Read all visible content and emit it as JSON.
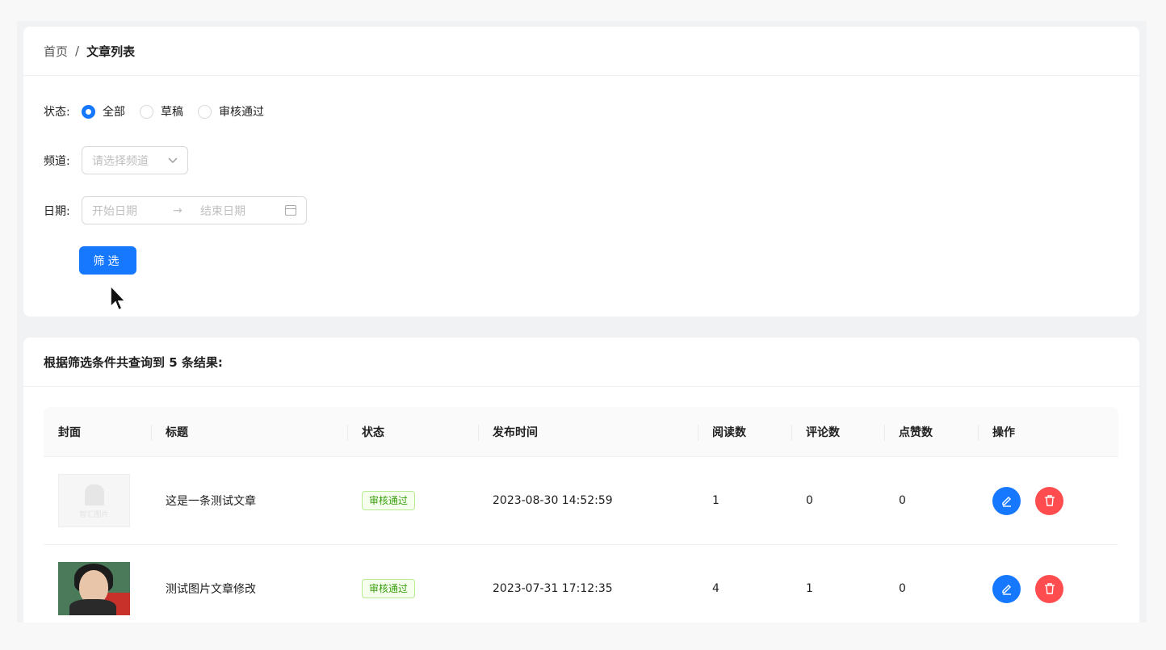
{
  "breadcrumb": {
    "home": "首页",
    "separator": "/",
    "current": "文章列表"
  },
  "filters": {
    "status": {
      "label": "状态:",
      "options": [
        {
          "label": "全部",
          "checked": true
        },
        {
          "label": "草稿",
          "checked": false
        },
        {
          "label": "审核通过",
          "checked": false
        }
      ]
    },
    "channel": {
      "label": "频道:",
      "placeholder": "请选择频道"
    },
    "date": {
      "label": "日期:",
      "start_placeholder": "开始日期",
      "arrow": "→",
      "end_placeholder": "结束日期"
    },
    "submit_label": "筛选"
  },
  "results": {
    "title": "根据筛选条件共查询到 5 条结果:",
    "columns": [
      "封面",
      "标题",
      "状态",
      "发布时间",
      "阅读数",
      "评论数",
      "点赞数",
      "操作"
    ],
    "rows": [
      {
        "cover": "placeholder",
        "cover_text": "智汇图片",
        "title": "这是一条测试文章",
        "status": "审核通过",
        "publish_time": "2023-08-30 14:52:59",
        "reads": "1",
        "comments": "0",
        "likes": "0"
      },
      {
        "cover": "photo",
        "title": "测试图片文章修改",
        "status": "审核通过",
        "publish_time": "2023-07-31 17:12:35",
        "reads": "4",
        "comments": "1",
        "likes": "0"
      }
    ]
  },
  "icons": {
    "select_arrow": "chevron-down-icon",
    "calendar": "calendar-icon",
    "edit": "edit-icon",
    "delete": "delete-icon",
    "cursor": "mouse-cursor-icon"
  },
  "colors": {
    "primary": "#1677ff",
    "danger": "#ff4d4f",
    "success_text": "#389e0d",
    "success_bg": "#f6ffed"
  }
}
